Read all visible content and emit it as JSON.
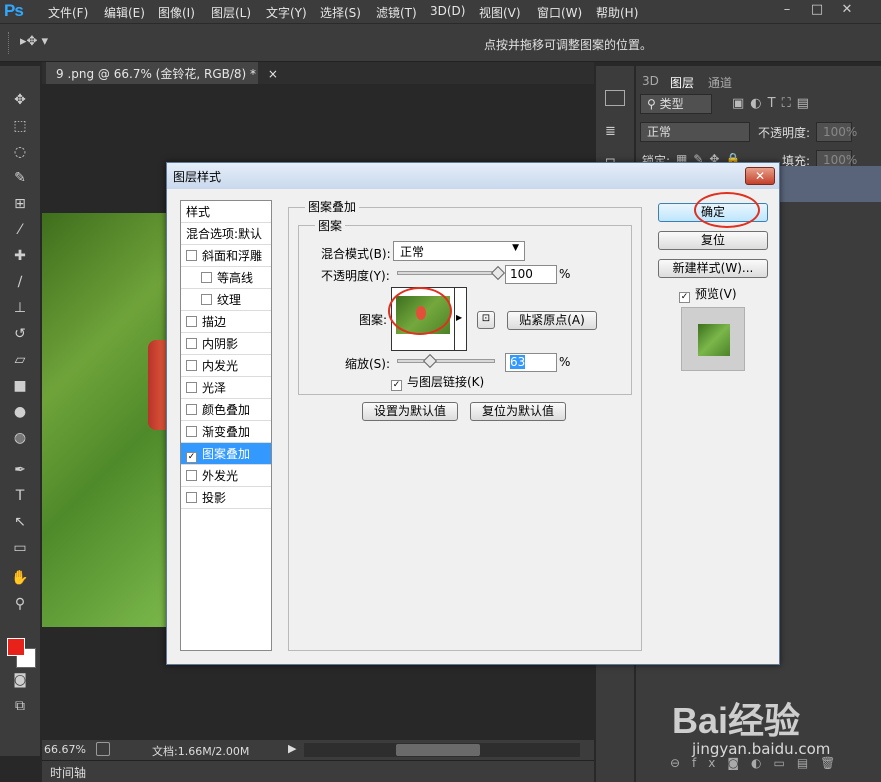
{
  "app": {
    "logo": "Ps"
  },
  "menu": [
    "文件(F)",
    "编辑(E)",
    "图像(I)",
    "图层(L)",
    "文字(Y)",
    "选择(S)",
    "滤镜(T)",
    "3D(D)",
    "视图(V)",
    "窗口(W)",
    "帮助(H)"
  ],
  "window_controls": {
    "minimize": "–",
    "maximize": "□",
    "close": "✕"
  },
  "options_bar": {
    "hint": "点按并拖移可调整图案的位置。"
  },
  "document": {
    "tab_title": "9 .png @ 66.7% (金铃花, RGB/8) *",
    "tab_close": "×"
  },
  "status": {
    "zoom": "66.67%",
    "doc_size": "文档:1.66M/2.00M"
  },
  "timeline": {
    "label": "时间轴"
  },
  "layers_panel": {
    "tabs": [
      "3D",
      "图层",
      "通道"
    ],
    "filter_kind": "类型",
    "blend_mode": "正常",
    "opacity_label": "不透明度:",
    "opacity_value": "100%",
    "lock_label": "锁定:",
    "fill_label": "填充:",
    "fill_value": "100%"
  },
  "dialog": {
    "title": "图层样式",
    "close": "✕",
    "style_list": [
      {
        "label": "样式",
        "checkbox": false,
        "indent": false,
        "checked": false
      },
      {
        "label": "混合选项:默认",
        "checkbox": false,
        "indent": false,
        "checked": false
      },
      {
        "label": "斜面和浮雕",
        "checkbox": true,
        "indent": false,
        "checked": false
      },
      {
        "label": "等高线",
        "checkbox": true,
        "indent": true,
        "checked": false
      },
      {
        "label": "纹理",
        "checkbox": true,
        "indent": true,
        "checked": false
      },
      {
        "label": "描边",
        "checkbox": true,
        "indent": false,
        "checked": false
      },
      {
        "label": "内阴影",
        "checkbox": true,
        "indent": false,
        "checked": false
      },
      {
        "label": "内发光",
        "checkbox": true,
        "indent": false,
        "checked": false
      },
      {
        "label": "光泽",
        "checkbox": true,
        "indent": false,
        "checked": false
      },
      {
        "label": "颜色叠加",
        "checkbox": true,
        "indent": false,
        "checked": false
      },
      {
        "label": "渐变叠加",
        "checkbox": true,
        "indent": false,
        "checked": false
      },
      {
        "label": "图案叠加",
        "checkbox": true,
        "indent": false,
        "checked": true
      },
      {
        "label": "外发光",
        "checkbox": true,
        "indent": false,
        "checked": false
      },
      {
        "label": "投影",
        "checkbox": true,
        "indent": false,
        "checked": false
      }
    ],
    "section_title": "图案叠加",
    "group_title": "图案",
    "blend_mode_label": "混合模式(B):",
    "blend_mode_value": "正常",
    "opacity_label": "不透明度(Y):",
    "opacity_value": "100",
    "opacity_fraction": 1.0,
    "percent": "%",
    "pattern_label": "图案:",
    "snap_origin": "贴紧原点(A)",
    "scale_label": "缩放(S):",
    "scale_value": "63",
    "scale_fraction": 0.3,
    "link_label": "与图层链接(K)",
    "link_checked": true,
    "make_default": "设置为默认值",
    "reset_default": "复位为默认值",
    "ok": "确定",
    "reset": "复位",
    "new_style": "新建样式(W)...",
    "preview_label": "预览(V)",
    "preview_checked": true
  },
  "watermark": {
    "brand": "Bai经验",
    "url": "jingyan.baidu.com"
  },
  "colors": {
    "ps_blue": "#31a8ff",
    "foreground": "#e8221a",
    "background": "#ffffff",
    "selection": "#3399ff",
    "highlight_circle": "#e03020"
  }
}
